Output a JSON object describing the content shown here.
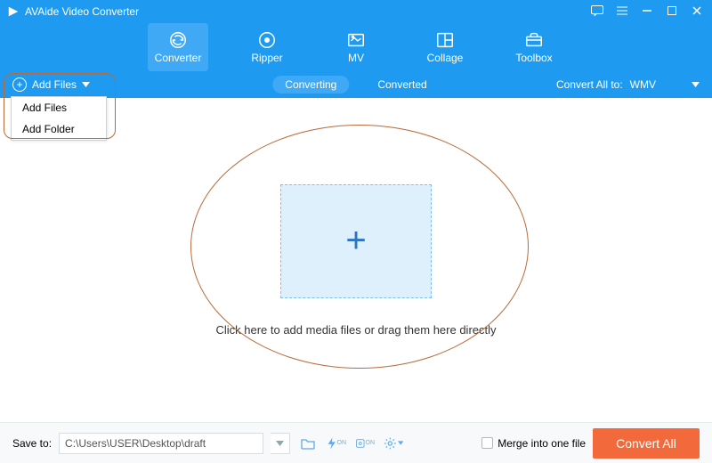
{
  "titlebar": {
    "app_name": "AVAide Video Converter"
  },
  "nav": {
    "items": [
      {
        "label": "Converter"
      },
      {
        "label": "Ripper"
      },
      {
        "label": "MV"
      },
      {
        "label": "Collage"
      },
      {
        "label": "Toolbox"
      }
    ]
  },
  "secondary": {
    "add_files_label": "Add Files",
    "tabs": {
      "converting": "Converting",
      "converted": "Converted"
    },
    "convert_all_to_label": "Convert All to:",
    "target_format": "WMV"
  },
  "dropdown": {
    "add_files": "Add Files",
    "add_folder": "Add Folder"
  },
  "main": {
    "instruction": "Click here to add media files or drag them here directly"
  },
  "footer": {
    "save_to_label": "Save to:",
    "save_path": "C:\\Users\\USER\\Desktop\\draft",
    "merge_label": "Merge into one file",
    "convert_label": "Convert All"
  }
}
